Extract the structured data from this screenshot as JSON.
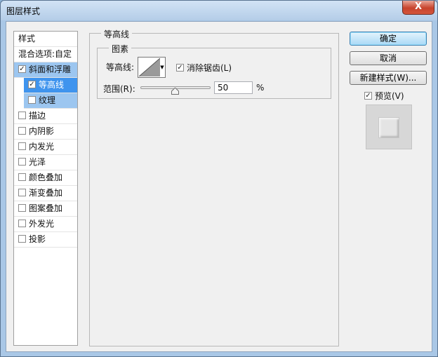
{
  "window": {
    "title": "图层样式",
    "close_label": "X"
  },
  "styles_panel": {
    "header": "样式",
    "blend_options": "混合选项:自定",
    "items": [
      {
        "label": "斜面和浮雕",
        "checked": true
      },
      {
        "label": "等高线",
        "checked": true
      },
      {
        "label": "纹理",
        "checked": false
      },
      {
        "label": "描边",
        "checked": false
      },
      {
        "label": "内阴影",
        "checked": false
      },
      {
        "label": "内发光",
        "checked": false
      },
      {
        "label": "光泽",
        "checked": false
      },
      {
        "label": "颜色叠加",
        "checked": false
      },
      {
        "label": "渐变叠加",
        "checked": false
      },
      {
        "label": "图案叠加",
        "checked": false
      },
      {
        "label": "外发光",
        "checked": false
      },
      {
        "label": "投影",
        "checked": false
      }
    ]
  },
  "contour_panel": {
    "group_title": "等高线",
    "subgroup_title": "图素",
    "contour_label": "等高线:",
    "anti_alias_label": "消除锯齿(L)",
    "anti_alias_checked": true,
    "range_label": "范围(R):",
    "range_value": "50",
    "range_unit": "%"
  },
  "buttons": {
    "ok": "确定",
    "cancel": "取消",
    "new_style": "新建样式(W)..."
  },
  "preview": {
    "label": "预览(V)",
    "checked": true
  },
  "colors": {
    "selected_row": "#3f94ee",
    "selected_parent": "#9cc6f0"
  }
}
